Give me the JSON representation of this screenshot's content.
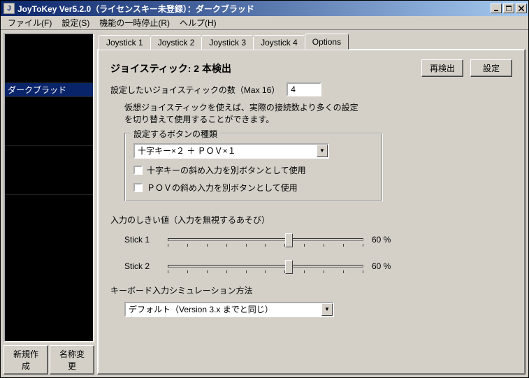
{
  "window": {
    "title": "JoyToKey  Ver5.2.0（ライセンスキー未登録）：ダークブラッド"
  },
  "menubar": {
    "file": "ファイル(F)",
    "settings": "設定(S)",
    "pause": "機能の一時停止(R)",
    "help": "ヘルプ(H)"
  },
  "sidebar": {
    "profiles": [
      "ダークブラッド"
    ],
    "new_btn": "新規作成",
    "rename_btn": "名称変更"
  },
  "tabs": {
    "items": [
      "Joystick 1",
      "Joystick 2",
      "Joystick 3",
      "Joystick 4",
      "Options"
    ],
    "active": 4
  },
  "options": {
    "heading": "ジョイスティック: 2 本検出",
    "redetect_btn": "再検出",
    "settings_btn": "設定",
    "count_label": "設定したいジョイスティックの数（Max 16）",
    "count_value": "4",
    "virtual_note": "仮想ジョイスティックを使えば、実際の接続数より多くの設定\nを切り替えて使用することができます。",
    "button_group": {
      "title": "設定するボタンの種類",
      "combo_value": "十字キー×２ ＋ ＰＯＶ×１",
      "chk_diag": "十字キーの斜め入力を別ボタンとして使用",
      "chk_pov_diag": "ＰＯＶの斜め入力を別ボタンとして使用"
    },
    "threshold": {
      "label": "入力のしきい値（入力を無視するあそび）",
      "stick1_label": "Stick 1",
      "stick1_value": "60 %",
      "stick1_pos": 60,
      "stick2_label": "Stick 2",
      "stick2_value": "60 %",
      "stick2_pos": 60
    },
    "keyboard_sim": {
      "label": "キーボード入力シミュレーション方法",
      "combo_value": "デフォルト（Version 3.x までと同じ）"
    }
  }
}
